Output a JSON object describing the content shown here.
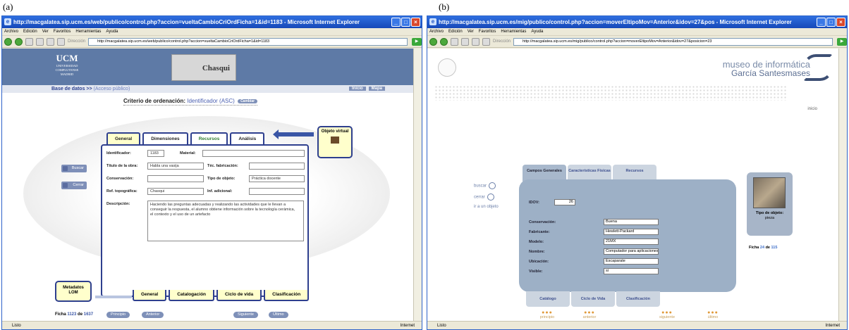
{
  "captions": {
    "a": "(a)",
    "b": "(b)"
  },
  "left": {
    "title": "http://macgalatea.sip.ucm.es/web/publico/control.php?accion=vueltaCambioCriOrdFicha=1&id=1183 - Microsoft Internet Explorer",
    "menu": [
      "Archivo",
      "Edición",
      "Ver",
      "Favoritos",
      "Herramientas",
      "Ayuda"
    ],
    "address_label": "Dirección",
    "address": "http://macgalatea.sip.ucm.es/web/publico/control.php?accion=vueltaCambioCriOrdFicha=1&id=1183",
    "logo_big": "UCM",
    "logo_small1": "UNIVERSIDAD",
    "logo_small2": "COMPLUTENSE",
    "logo_small3": "MADRID",
    "banner": "Chasqui",
    "breadcrumb": "Base de datos >> ",
    "access": "(Acceso público)",
    "inicio": "Inicio",
    "mapa": "Mapa",
    "sort_label": "Criterio de ordenación: ",
    "sort_value": "Identificador (ASC)",
    "cambiar": "Cambiar",
    "buscar": "Buscar",
    "cerrar": "Cerrar",
    "tabs": [
      "General",
      "Dimensiones",
      "Recursos",
      "Análisis"
    ],
    "objeto_virtual": "Objeto virtual",
    "fields": {
      "id_label": "Identificador:",
      "id_value": "1183",
      "material_label": "Material:",
      "titulo_label": "Título de la obra:",
      "titulo_value": "Habla una vasija",
      "tec_label": "Téc. fabricación:",
      "conserv_label": "Conservación:",
      "tipo_label": "Tipo de objeto:",
      "tipo_value": "Práctica docente",
      "ref_label": "Ref. topográfica:",
      "ref_value": "Chasqui",
      "inf_label": "Inf. adicional:",
      "desc_label": "Descripción:",
      "desc_value": "Haciendo las preguntas adecuadas y realizando las actividades que le llevan a conseguir la respuesta, el alumno obtiene información sobre la tecnología cerámica, el contexto y el uso de un artefacto"
    },
    "metadatos": "Metadatos",
    "lom": "LOM",
    "bottom_tabs": [
      "General",
      "Catalogación",
      "Ciclo de vida",
      "Clasificación"
    ],
    "ficha_label": "Ficha",
    "ficha_n": "1123",
    "ficha_de": "de",
    "ficha_total": "1637",
    "principio": "Principio",
    "anterior": "Anterior",
    "siguiente": "Siguiente",
    "ultimo": "Último",
    "status": "Listo",
    "zone": "Internet"
  },
  "right": {
    "title": "http://macgalatea.sip.ucm.es/mig/publico/control.php?accion=moverEltipoMov=Anterior&idov=27&pos - Microsoft Internet Explorer",
    "menu": [
      "Archivo",
      "Edición",
      "Ver",
      "Favoritos",
      "Herramientas",
      "Ayuda"
    ],
    "address_label": "Dirección",
    "address": "http://macgalatea.sip.ucm.es/mig/publico/control.php?accion=moverEltipoMov=Anterior&idov=27&posicion=23",
    "museo": "museo de informática",
    "garcia": "García Santesmases",
    "inicio": "inicio",
    "tabs": [
      "Campos Generales",
      "Características Físicas",
      "Recursos"
    ],
    "idov_label": "IDOV:",
    "idov_value": "26",
    "buscar": "buscar",
    "cerrar": "cerrar",
    "ir": "ir a un objeto",
    "fields": [
      {
        "label": "Conservación:",
        "value": "Buena"
      },
      {
        "label": "Fabricante:",
        "value": "Hewlett-Packard"
      },
      {
        "label": "Modelo:",
        "value": "21MX"
      },
      {
        "label": "Nombre:",
        "value": "Computador para aplicaciones"
      },
      {
        "label": "Ubicación:",
        "value": "Escaparate"
      },
      {
        "label": "Visible:",
        "value": "si"
      }
    ],
    "tipo_label": "Tipo de objeto:",
    "tipo_value": "pieza",
    "ficha_label": "Ficha",
    "ficha_n": "24",
    "ficha_de": "de",
    "ficha_total": "115",
    "bottom_tabs": [
      "Catálogo",
      "Ciclo de Vida",
      "Clasificación"
    ],
    "pager": [
      "principio",
      "anterior",
      "siguiente",
      "último"
    ],
    "status": "Listo",
    "zone": "Internet"
  }
}
